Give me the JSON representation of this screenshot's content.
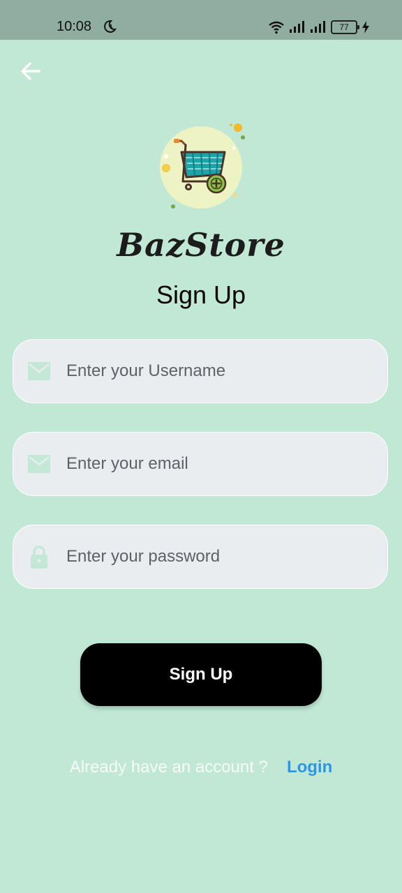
{
  "status_bar": {
    "time": "10:08",
    "battery": "77"
  },
  "app": {
    "brand_name": "BazStore",
    "page_title": "Sign Up"
  },
  "form": {
    "username": {
      "placeholder": "Enter your Username",
      "value": "",
      "icon": "mail-icon"
    },
    "email": {
      "placeholder": "Enter your email",
      "value": "",
      "icon": "mail-icon"
    },
    "password": {
      "placeholder": "Enter your password",
      "value": "",
      "icon": "lock-icon"
    }
  },
  "buttons": {
    "signup_label": "Sign Up"
  },
  "footer": {
    "account_text": "Already have an account ?",
    "login_label": "Login"
  },
  "colors": {
    "background": "#c0e8d5",
    "status_bar": "#8fada0",
    "field_bg": "#e9edf0",
    "button_bg": "#000000",
    "link": "#2b97e4"
  }
}
